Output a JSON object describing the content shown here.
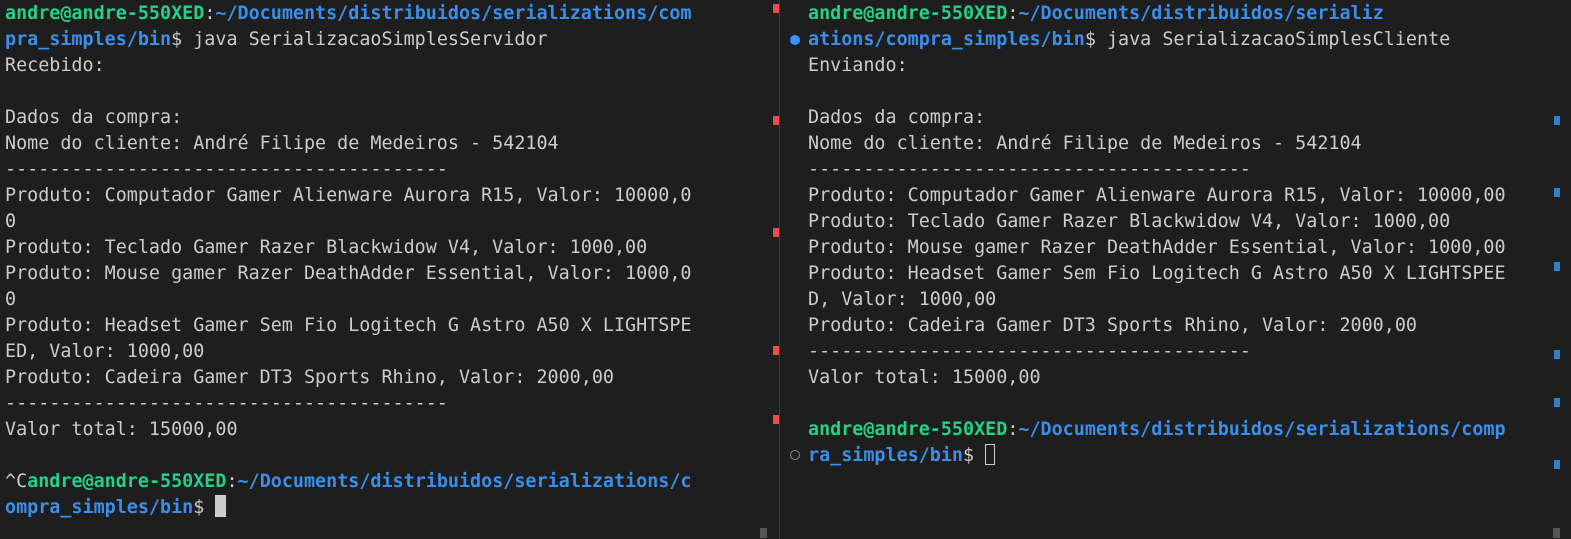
{
  "left_terminal": {
    "lines": [
      {
        "type": "prompt",
        "prefix": "",
        "user": "andre@andre-550XED",
        "sep": ":",
        "path": "~/Documents/distribuidos/serializations/com",
        "tail": ""
      },
      {
        "type": "prompt_cont",
        "path": "pra_simples/bin",
        "tail": "$ java SerializacaoSimplesServidor"
      },
      {
        "type": "text",
        "text": "Recebido:"
      },
      {
        "type": "text",
        "text": ""
      },
      {
        "type": "text",
        "text": "Dados da compra:"
      },
      {
        "type": "text",
        "text": "Nome do cliente: André Filipe de Medeiros - 542104"
      },
      {
        "type": "text",
        "text": "----------------------------------------"
      },
      {
        "type": "text",
        "text": "Produto: Computador Gamer Alienware Aurora R15, Valor: 10000,0"
      },
      {
        "type": "text",
        "text": "0"
      },
      {
        "type": "text",
        "text": "Produto: Teclado Gamer Razer Blackwidow V4, Valor: 1000,00"
      },
      {
        "type": "text",
        "text": "Produto: Mouse gamer Razer DeathAdder Essential, Valor: 1000,0"
      },
      {
        "type": "text",
        "text": "0"
      },
      {
        "type": "text",
        "text": "Produto: Headset Gamer Sem Fio Logitech G Astro A50 X LIGHTSPE"
      },
      {
        "type": "text",
        "text": "ED, Valor: 1000,00"
      },
      {
        "type": "text",
        "text": "Produto: Cadeira Gamer DT3 Sports Rhino, Valor: 2000,00"
      },
      {
        "type": "text",
        "text": "----------------------------------------"
      },
      {
        "type": "text",
        "text": "Valor total: 15000,00"
      },
      {
        "type": "text",
        "text": ""
      },
      {
        "type": "prompt",
        "prefix": "^C",
        "user": "andre@andre-550XED",
        "sep": ":",
        "path": "~/Documents/distribuidos/serializations/c",
        "tail": ""
      },
      {
        "type": "prompt_cont",
        "path": "ompra_simples/bin",
        "tail": "$ ",
        "cursor": "block"
      }
    ]
  },
  "right_terminal": {
    "lines": [
      {
        "type": "prompt",
        "prefix": "",
        "user": "andre@andre-550XED",
        "sep": ":",
        "path": "~/Documents/distribuidos/serializ",
        "tail": ""
      },
      {
        "type": "prompt_cont",
        "path": "ations/compra_simples/bin",
        "tail": "$ java SerializacaoSimplesCliente"
      },
      {
        "type": "text",
        "text": "Enviando:"
      },
      {
        "type": "text",
        "text": ""
      },
      {
        "type": "text",
        "text": "Dados da compra:"
      },
      {
        "type": "text",
        "text": "Nome do cliente: André Filipe de Medeiros - 542104"
      },
      {
        "type": "text",
        "text": "----------------------------------------"
      },
      {
        "type": "text",
        "text": "Produto: Computador Gamer Alienware Aurora R15, Valor: 10000,00"
      },
      {
        "type": "text",
        "text": "Produto: Teclado Gamer Razer Blackwidow V4, Valor: 1000,00"
      },
      {
        "type": "text",
        "text": "Produto: Mouse gamer Razer DeathAdder Essential, Valor: 1000,00"
      },
      {
        "type": "text",
        "text": "Produto: Headset Gamer Sem Fio Logitech G Astro A50 X LIGHTSPEE"
      },
      {
        "type": "text",
        "text": "D, Valor: 1000,00"
      },
      {
        "type": "text",
        "text": "Produto: Cadeira Gamer DT3 Sports Rhino, Valor: 2000,00"
      },
      {
        "type": "text",
        "text": "----------------------------------------"
      },
      {
        "type": "text",
        "text": "Valor total: 15000,00"
      },
      {
        "type": "text",
        "text": ""
      },
      {
        "type": "prompt",
        "prefix": "",
        "user": "andre@andre-550XED",
        "sep": ":",
        "path": "~/Documents/distribuidos/serializations/comp",
        "tail": ""
      },
      {
        "type": "prompt_cont",
        "path": "ra_simples/bin",
        "tail": "$ ",
        "cursor": "outline"
      }
    ]
  },
  "colors": {
    "background": "#1e1e1e",
    "foreground": "#cccccc",
    "user": "#23d18b",
    "path": "#3b8eea",
    "error_marker": "#f14c4c",
    "info_marker": "#2d7fcf"
  },
  "icons": {
    "left_command_marker": "circle-filled-icon",
    "right_command_marker": "circle-hollow-icon"
  }
}
